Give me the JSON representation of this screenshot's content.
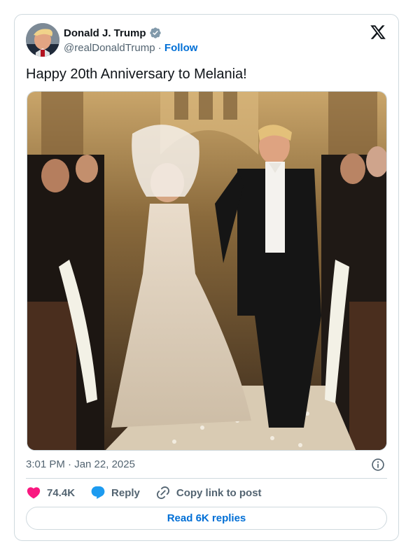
{
  "author": {
    "name": "Donald J. Trump",
    "handle": "@realDonaldTrump",
    "separator": "·",
    "follow_label": "Follow",
    "verified": true
  },
  "tweet": {
    "text": "Happy 20th Anniversary to Melania!",
    "timestamp": "3:01 PM · Jan 22, 2025"
  },
  "actions": {
    "likes": "74.4K",
    "reply_label": "Reply",
    "copy_link_label": "Copy link to post"
  },
  "read_replies_label": "Read 6K replies",
  "icons": {
    "verified": "verified-badge-icon",
    "platform": "x-logo-icon",
    "info": "info-icon",
    "like": "heart-icon",
    "reply": "reply-bubble-icon",
    "link": "link-icon"
  },
  "colors": {
    "like": "#f91880",
    "reply": "#1d9bf0",
    "link_text": "#006fd6",
    "secondary_text": "#536471",
    "border": "#cfd9de"
  }
}
